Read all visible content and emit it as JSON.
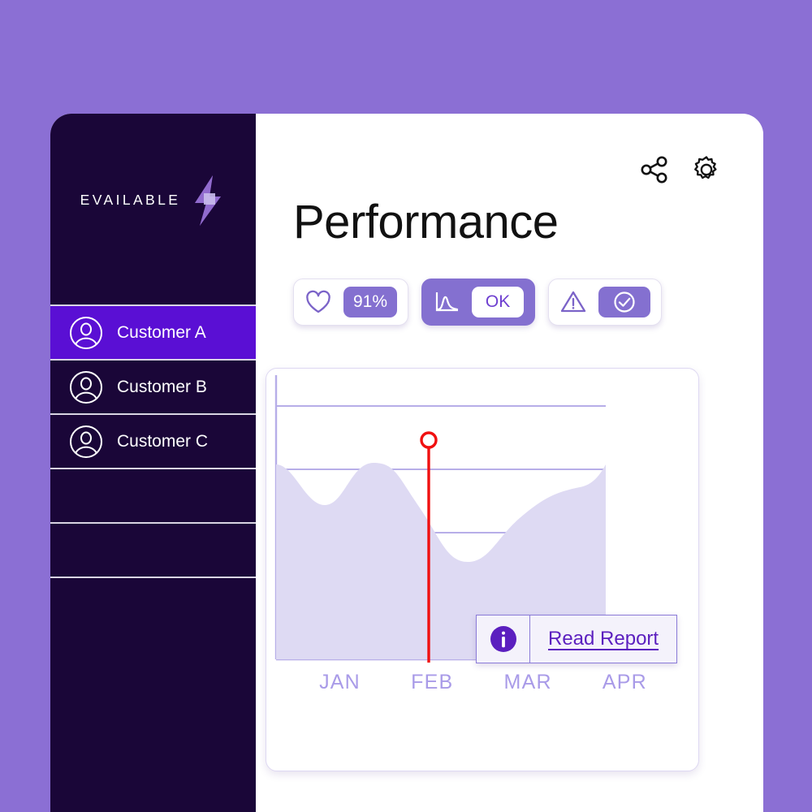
{
  "theme": {
    "page_background": "#8B6FD4",
    "sidebar_background": "#1A0638",
    "active_item_background": "#5A0FD4",
    "badge_purple": "#8470D0",
    "accent_purple": "#5B1FBF",
    "marker_red": "#F01010",
    "area_fill": "#DEDAF3",
    "gridline": "#B7AEE8",
    "axis_label_color": "#A99BE8"
  },
  "sidebar": {
    "brand": {
      "name": "EVAILABLE",
      "logo_icon": "lightning-bolt-icon"
    },
    "items": [
      {
        "label": "Customer A",
        "icon": "user-circle-icon",
        "active": true
      },
      {
        "label": "Customer B",
        "icon": "user-circle-icon",
        "active": false
      },
      {
        "label": "Customer C",
        "icon": "user-circle-icon",
        "active": false
      },
      {
        "label": "",
        "icon": "",
        "active": false
      },
      {
        "label": "",
        "icon": "",
        "active": false
      },
      {
        "label": "",
        "icon": "",
        "active": false
      }
    ]
  },
  "header": {
    "title": "Performance",
    "actions": [
      {
        "name": "share-icon",
        "label": "Share"
      },
      {
        "name": "settings-gear-icon",
        "label": "Settings"
      }
    ]
  },
  "status_badges": [
    {
      "id": "health",
      "icon": "heart-icon",
      "value": "91%",
      "value_style": "purple",
      "card_style": "outline"
    },
    {
      "id": "trend",
      "icon": "analytics-curve-icon",
      "value": "OK",
      "value_style": "white",
      "card_style": "filled"
    },
    {
      "id": "alerts",
      "icon": "warning-triangle-icon",
      "value": "",
      "value_icon": "check-circle-icon",
      "value_style": "purple",
      "card_style": "outline"
    }
  ],
  "chart_data": {
    "type": "area",
    "title": "",
    "xlabel": "",
    "ylabel": "",
    "categories": [
      "JAN",
      "FEB",
      "MAR",
      "APR"
    ],
    "tick_labels": [
      "JAN",
      "FEB",
      "MAR",
      "APR"
    ],
    "x": [
      0,
      0.14,
      0.26,
      0.38,
      0.5,
      0.62,
      0.72,
      0.85,
      1
    ],
    "values": [
      62,
      44,
      66,
      62,
      40,
      30,
      40,
      58,
      70
    ],
    "ylim": [
      0,
      100
    ],
    "grid": true,
    "gridline_count": 4,
    "legend": "none",
    "marker": {
      "label": "",
      "x_fraction": 0.45,
      "color": "#F01010",
      "shape": "circle-on-stem"
    },
    "annotation": {
      "icon": "info-icon",
      "link_text": "Read Report"
    }
  },
  "tooltip": {
    "icon": "info-icon",
    "link_text": "Read Report"
  }
}
